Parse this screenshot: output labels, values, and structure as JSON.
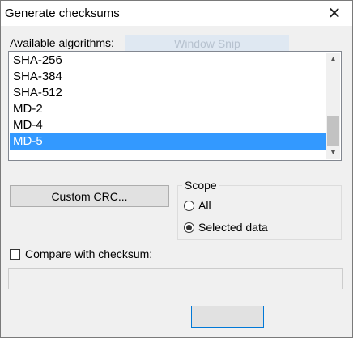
{
  "window": {
    "title": "Generate checksums",
    "close_symbol": "✕"
  },
  "algorithms": {
    "label": "Available algorithms:",
    "items": [
      "SHA-256",
      "SHA-384",
      "SHA-512",
      "MD-2",
      "MD-4",
      "MD-5"
    ],
    "selected": "MD-5"
  },
  "overlay": {
    "window_snip": "Window Snip"
  },
  "buttons": {
    "custom_crc": "Custom CRC..."
  },
  "scope": {
    "title": "Scope",
    "options": [
      "All",
      "Selected data"
    ],
    "selected": "Selected data"
  },
  "compare": {
    "label": "Compare with checksum:",
    "checked": false,
    "value": ""
  },
  "colors": {
    "selection": "#3399ff",
    "accent": "#0078d7"
  }
}
